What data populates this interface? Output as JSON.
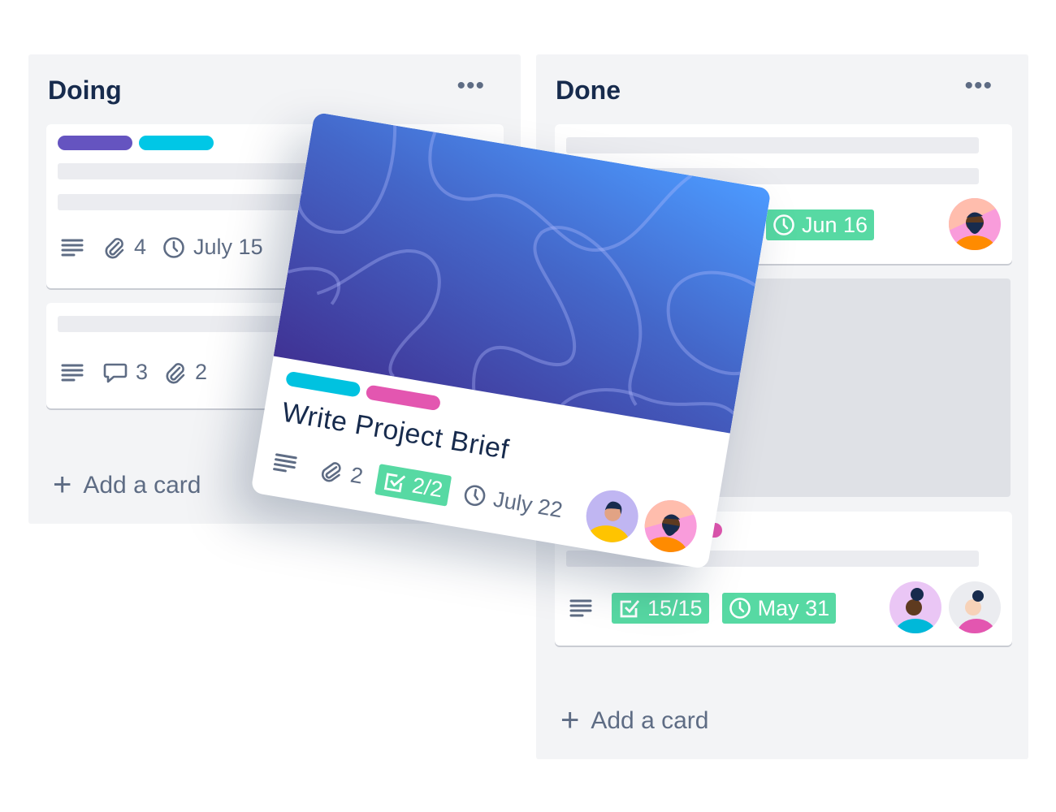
{
  "lists": [
    {
      "title": "Doing",
      "menu": "•••",
      "add_card": "+ Add a card",
      "cards": [
        {
          "labels": [
            "#6554c0",
            "#00c7e6"
          ],
          "attachments": "4",
          "due": "July 15"
        },
        {
          "comments": "3",
          "attachments": "2"
        }
      ]
    },
    {
      "title": "Done",
      "menu": "•••",
      "add_card": "+ Add a card",
      "cards": [
        {
          "due": "Jun 16"
        },
        {
          "checklist": "15/15",
          "due": "May 31"
        }
      ]
    }
  ],
  "dragged_card": {
    "title": "Write Project Brief",
    "labels": [
      "#00c2e0",
      "#e356b0"
    ],
    "attachments": "2",
    "checklist": "2/2",
    "due": "July 22"
  },
  "add_label": "Add a card",
  "colors": {
    "green_badge": "#57d9a3",
    "list_bg": "#f3f4f6",
    "text": "#172b4d",
    "muted": "#5e6c84"
  }
}
